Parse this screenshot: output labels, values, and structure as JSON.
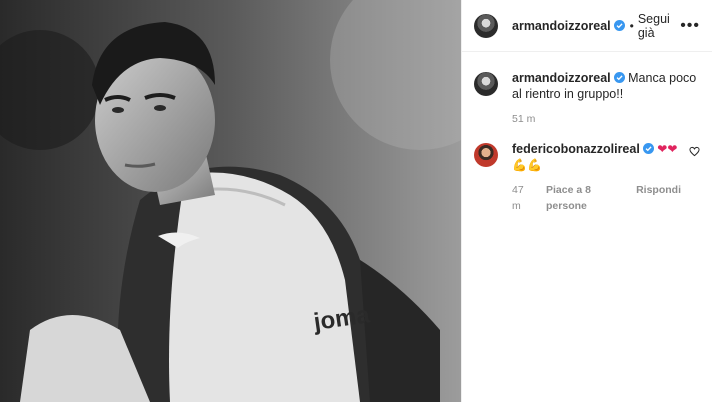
{
  "post": {
    "image_alt": "Black and white photo of a football player wearing a training bib",
    "bib_brand": "joma"
  },
  "header": {
    "username": "armandoizzoreal",
    "separator": "•",
    "follow_label": "Segui già",
    "more_icon": "more-horizontal-icon"
  },
  "caption": {
    "username": "armandoizzoreal",
    "text": "Manca poco al rientro in gruppo!!",
    "time": "51 m"
  },
  "comments": [
    {
      "username": "federicobonazzolireal",
      "hearts": "❤❤",
      "muscles": "💪💪",
      "time": "47 m",
      "likes": "Piace a 8 persone",
      "reply_label": "Rispondi"
    }
  ],
  "colors": {
    "verified": "#3897f0",
    "heart_emoji": "#e0245e"
  }
}
